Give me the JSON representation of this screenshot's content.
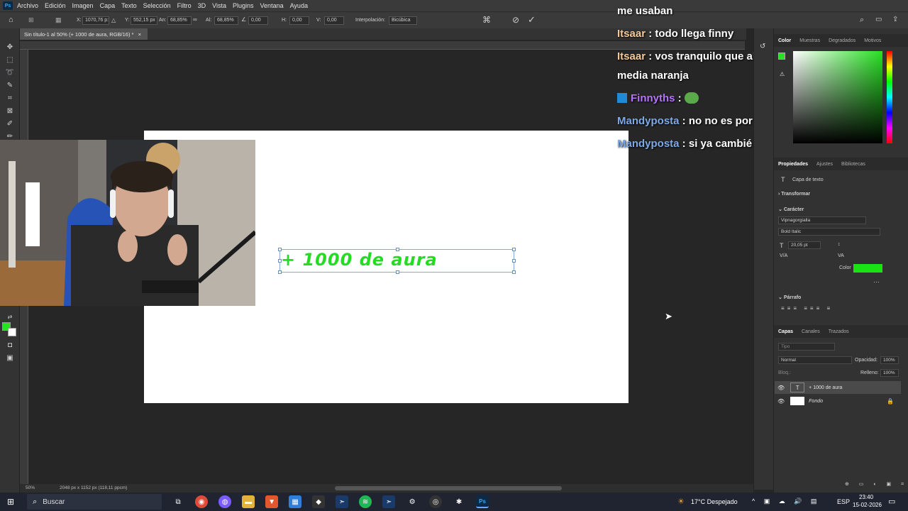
{
  "menubar": {
    "items": [
      "Archivo",
      "Edición",
      "Imagen",
      "Capa",
      "Texto",
      "Selección",
      "Filtro",
      "3D",
      "Vista",
      "Plugins",
      "Ventana",
      "Ayuda"
    ]
  },
  "options": {
    "x_label": "X:",
    "x_value": "1070,76 p:",
    "y_label": "Y:",
    "y_value": "552,15 px",
    "w_label": "An:",
    "w_value": "68,85%",
    "h_label": "Al:",
    "h_value": "68,85%",
    "rot_value": "0,00",
    "hs_label": "H:",
    "hs_value": "0,00",
    "vs_label": "V:",
    "vs_value": "0,00",
    "interp_label": "Interpolación:",
    "interp_value": "Bicúbica"
  },
  "document": {
    "tab_title": "Sin título-1 al 50% (+ 1000 de aura, RGB/16) *",
    "canvas_text": "+ 1000 de aura",
    "zoom": "50%",
    "dimensions": "2048 px x 1152 px (118,11 ppcm)"
  },
  "chat": {
    "messages": [
      {
        "user": "",
        "text": "me usaban",
        "user_color": "#ffffff"
      },
      {
        "user": "Itsaar",
        "text": " : todo llega finny",
        "user_color": "#f3c99a"
      },
      {
        "user": "Itsaar",
        "text": " : vos tranquilo que algun dia llegara tu",
        "user_color": "#f3c99a"
      },
      {
        "user": "",
        "text": "media naranja",
        "user_color": "#ffffff"
      },
      {
        "user": "Finnyths",
        "text": " : ",
        "user_color": "#b574ff"
      },
      {
        "user": "Mandyposta",
        "text": " : no no es por esooooo",
        "user_color": "#7fa8e6"
      },
      {
        "user": "Mandyposta",
        "text": " : si ya cambié demasiado",
        "user_color": "#7fa8e6"
      }
    ]
  },
  "color_panel": {
    "tabs": [
      "Color",
      "Muestras",
      "Degradados",
      "Motivos"
    ],
    "active": "Color",
    "selected_color": "#22e51f"
  },
  "properties": {
    "tabs": [
      "Propiedades",
      "Ajustes",
      "Bibliotecas"
    ],
    "layer_type": "Capa de texto",
    "transform_label": "Transformar",
    "character_label": "Carácter",
    "font_family": "Vipnagorgialla",
    "font_style": "Bold Italic",
    "font_size": "20,05 pt",
    "color_label": "Color",
    "text_color": "#19e312",
    "paragraph_label": "Párrafo"
  },
  "layers": {
    "tabs": [
      "Capas",
      "Canales",
      "Trazados"
    ],
    "search_placeholder": "Tipo",
    "blend_mode": "Normal",
    "opacity_label": "Opacidad:",
    "opacity_value": "100%",
    "lock_label": "Bloq.:",
    "fill_label": "Relleno:",
    "fill_value": "100%",
    "items": [
      {
        "name": "+ 1000 de aura"
      },
      {
        "name": "Fondo"
      }
    ]
  },
  "taskbar": {
    "search_label": "Buscar",
    "weather": "17°C  Despejado",
    "language": "ESP",
    "time": "23:40",
    "date": "15-02-2026"
  }
}
